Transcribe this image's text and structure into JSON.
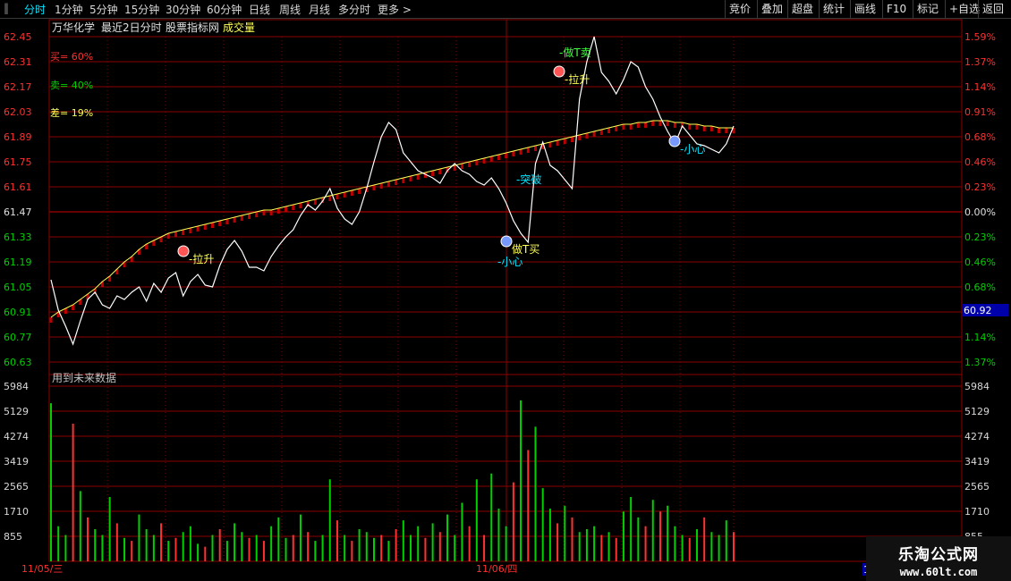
{
  "toolbar": {
    "tabs": [
      "分时",
      "1分钟",
      "5分钟",
      "15分钟",
      "30分钟",
      "60分钟",
      "日线",
      "周线",
      "月线",
      "多分时",
      "更多 >"
    ],
    "right_buttons": [
      "竞价",
      "叠加",
      "超盘",
      "统计",
      "画线",
      "F10",
      "标记",
      "+自选",
      "返回"
    ]
  },
  "header": {
    "stock_name": "万华化学",
    "range": "最近2日分时",
    "source": "股票指标网",
    "volume_label": "成交量"
  },
  "colors": {
    "up": "#ff3030",
    "down": "#00d000",
    "price": "#ffffff",
    "avg": "#ffff55",
    "grid": "#8b0000",
    "accent": "#00e5ff"
  },
  "indicators": {
    "buy": "买= 60%",
    "sell": "卖= 40%",
    "diff": "差= 19%"
  },
  "future_data_note": "用到未来数据",
  "current_price_tag": "60.92",
  "dates": [
    "11/05/三",
    "11/06/四"
  ],
  "bottom_right_tag": "14",
  "watermark": {
    "line1": "乐淘公式网",
    "line2": "www.60lt.com"
  },
  "annotations": {
    "pull_up_1": "-拉升",
    "pull_up_2": "-拉升",
    "do_t_sell": "-做T卖",
    "do_t_buy": "做T买",
    "careful_1": "-小心",
    "careful_2": "-小心",
    "break": "-突破"
  },
  "chart_data": {
    "type": "line",
    "price_axis_left": [
      "62.45",
      "62.31",
      "62.17",
      "62.03",
      "61.89",
      "61.75",
      "61.61",
      "61.47",
      "61.33",
      "61.19",
      "61.05",
      "60.91",
      "60.77",
      "60.63"
    ],
    "price_axis_right": [
      "1.59%",
      "1.37%",
      "1.14%",
      "0.91%",
      "0.68%",
      "0.46%",
      "0.23%",
      "0.00%",
      "0.23%",
      "0.46%",
      "0.68%",
      "0.91%",
      "1.14%",
      "1.37%"
    ],
    "volume_axis": [
      "5984",
      "5129",
      "4274",
      "3419",
      "2565",
      "1710",
      "855"
    ],
    "volume_axis_right": [
      "5984",
      "5129",
      "4274",
      "3419",
      "2565",
      "1710",
      "855"
    ],
    "ylim_price": [
      60.63,
      62.45
    ],
    "ylim_volume": [
      0,
      5984
    ],
    "sessions": [
      "11/05/三",
      "11/06/四"
    ],
    "price_series": {
      "name": "price",
      "values": [
        61.09,
        60.92,
        60.83,
        60.73,
        60.86,
        60.98,
        61.02,
        60.95,
        60.93,
        61.0,
        60.98,
        61.02,
        61.05,
        60.97,
        61.07,
        61.02,
        61.1,
        61.13,
        61.0,
        61.08,
        61.12,
        61.06,
        61.05,
        61.17,
        61.26,
        61.31,
        61.25,
        61.16,
        61.16,
        61.14,
        61.22,
        61.28,
        61.33,
        61.37,
        61.45,
        61.51,
        61.48,
        61.53,
        61.6,
        61.49,
        61.43,
        61.4,
        61.47,
        61.6,
        61.75,
        61.89,
        61.97,
        61.93,
        61.8,
        61.75,
        61.7,
        61.68,
        61.66,
        61.63,
        61.7,
        61.74,
        61.7,
        61.68,
        61.64,
        61.62,
        61.66,
        61.6,
        61.52,
        61.42,
        61.35,
        61.3,
        61.74,
        61.86,
        61.73,
        61.7,
        61.65,
        61.6,
        62.1,
        62.31,
        62.45,
        62.25,
        62.2,
        62.13,
        62.21,
        62.31,
        62.28,
        62.17,
        62.1,
        62.0,
        61.92,
        61.85,
        61.95,
        61.9,
        61.85,
        61.84,
        61.82,
        61.8,
        61.85,
        61.95
      ]
    },
    "avg_series": {
      "name": "avg",
      "values": [
        60.88,
        60.91,
        60.93,
        60.95,
        60.98,
        61.01,
        61.04,
        61.08,
        61.11,
        61.15,
        61.19,
        61.22,
        61.26,
        61.29,
        61.31,
        61.33,
        61.35,
        61.36,
        61.37,
        61.38,
        61.39,
        61.4,
        61.41,
        61.42,
        61.43,
        61.44,
        61.45,
        61.46,
        61.47,
        61.48,
        61.48,
        61.49,
        61.5,
        61.51,
        61.52,
        61.53,
        61.54,
        61.55,
        61.56,
        61.57,
        61.58,
        61.59,
        61.6,
        61.61,
        61.62,
        61.63,
        61.64,
        61.65,
        61.66,
        61.67,
        61.68,
        61.69,
        61.7,
        61.71,
        61.72,
        61.73,
        61.74,
        61.75,
        61.76,
        61.77,
        61.78,
        61.79,
        61.8,
        61.81,
        61.82,
        61.83,
        61.84,
        61.85,
        61.86,
        61.87,
        61.88,
        61.89,
        61.9,
        61.91,
        61.92,
        61.93,
        61.94,
        61.95,
        61.96,
        61.96,
        61.97,
        61.97,
        61.98,
        61.98,
        61.98,
        61.97,
        61.97,
        61.96,
        61.96,
        61.95,
        61.95,
        61.94,
        61.94,
        61.94
      ]
    },
    "volume_values": [
      5400,
      1200,
      900,
      4700,
      2400,
      1500,
      1100,
      900,
      2200,
      1300,
      800,
      700,
      1600,
      1100,
      900,
      1300,
      700,
      800,
      1000,
      1200,
      600,
      500,
      900,
      1100,
      700,
      1300,
      1000,
      800,
      900,
      700,
      1200,
      1500,
      800,
      900,
      1600,
      1000,
      700,
      900,
      2800,
      1400,
      900,
      700,
      1100,
      1000,
      800,
      900,
      700,
      1100,
      1400,
      900,
      1200,
      800,
      1300,
      1000,
      1600,
      900,
      2000,
      1200,
      2800,
      900,
      3000,
      1800,
      1200,
      2700,
      5500,
      3800,
      4600,
      2500,
      1800,
      1300,
      1900,
      1500,
      1000,
      1100,
      1200,
      900,
      1000,
      800,
      1700,
      2200,
      1500,
      1200,
      2100,
      1700,
      1900,
      1200,
      900,
      800,
      1100,
      1500,
      1000,
      900,
      1400,
      1000
    ]
  }
}
